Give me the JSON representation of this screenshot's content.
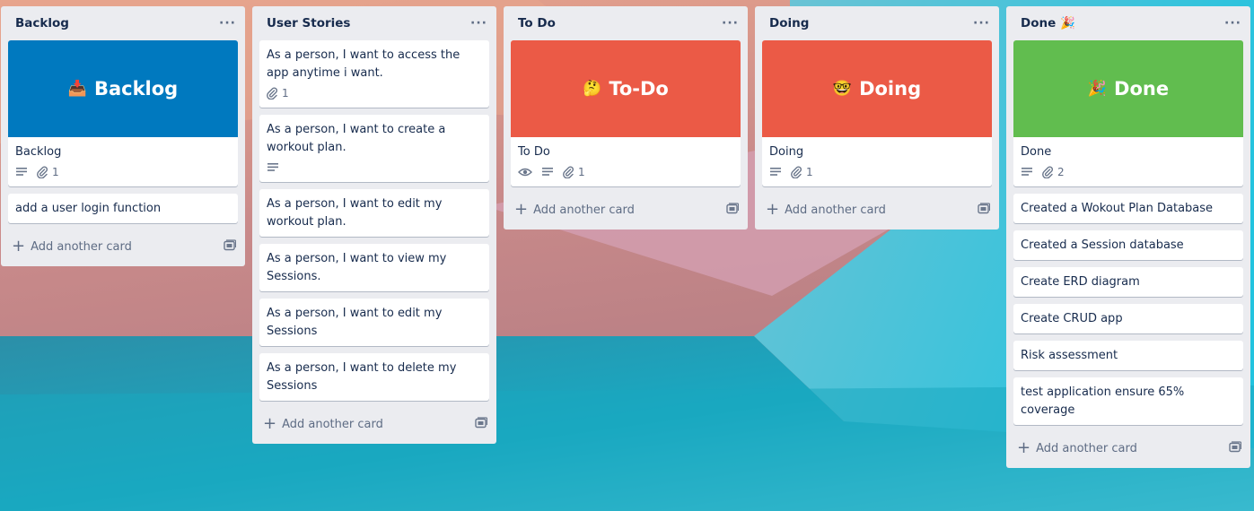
{
  "colors": {
    "list_bg": "#ebecf0",
    "backlog_cover": "#0079bf",
    "todo_cover": "#eb5a46",
    "doing_cover": "#eb5a46",
    "done_cover": "#61bd4f"
  },
  "lists": [
    {
      "title": "Backlog",
      "menu": "···",
      "cover_card": {
        "cover_emoji": "📥",
        "cover_text": "Backlog",
        "title": "Backlog",
        "attachments": "1"
      },
      "cards": [
        "add a user login function"
      ],
      "add_label": "Add another card"
    },
    {
      "title": "User Stories",
      "menu": "···",
      "cards": [
        {
          "text": "As a person, I want to access the app anytime i want.",
          "attachments": "1"
        },
        {
          "text": "As a person, I want to create a workout plan."
        },
        {
          "text": "As a person, I want to edit my workout plan."
        },
        {
          "text": "As a person, I want to view my Sessions."
        },
        {
          "text": "As a person, I want to edit my Sessions"
        },
        {
          "text": "As a person, I want to delete my Sessions"
        }
      ],
      "add_label": "Add another card"
    },
    {
      "title": "To Do",
      "menu": "···",
      "cover_card": {
        "cover_emoji": "🤔",
        "cover_text": "To-Do",
        "title": "To Do",
        "attachments": "1"
      },
      "add_label": "Add another card"
    },
    {
      "title": "Doing",
      "menu": "···",
      "cover_card": {
        "cover_emoji": "🤓",
        "cover_text": "Doing",
        "title": "Doing",
        "attachments": "1"
      },
      "add_label": "Add another card"
    },
    {
      "title": "Done 🎉",
      "menu": "···",
      "cover_card": {
        "cover_emoji": "🎉",
        "cover_text": "Done",
        "title": "Done",
        "attachments": "2"
      },
      "cards": [
        "Created a Wokout Plan Database",
        "Created a Session database",
        "Create ERD diagram",
        "Create CRUD app",
        "Risk assessment",
        "test application ensure 65% coverage"
      ],
      "add_label": "Add another card"
    }
  ]
}
